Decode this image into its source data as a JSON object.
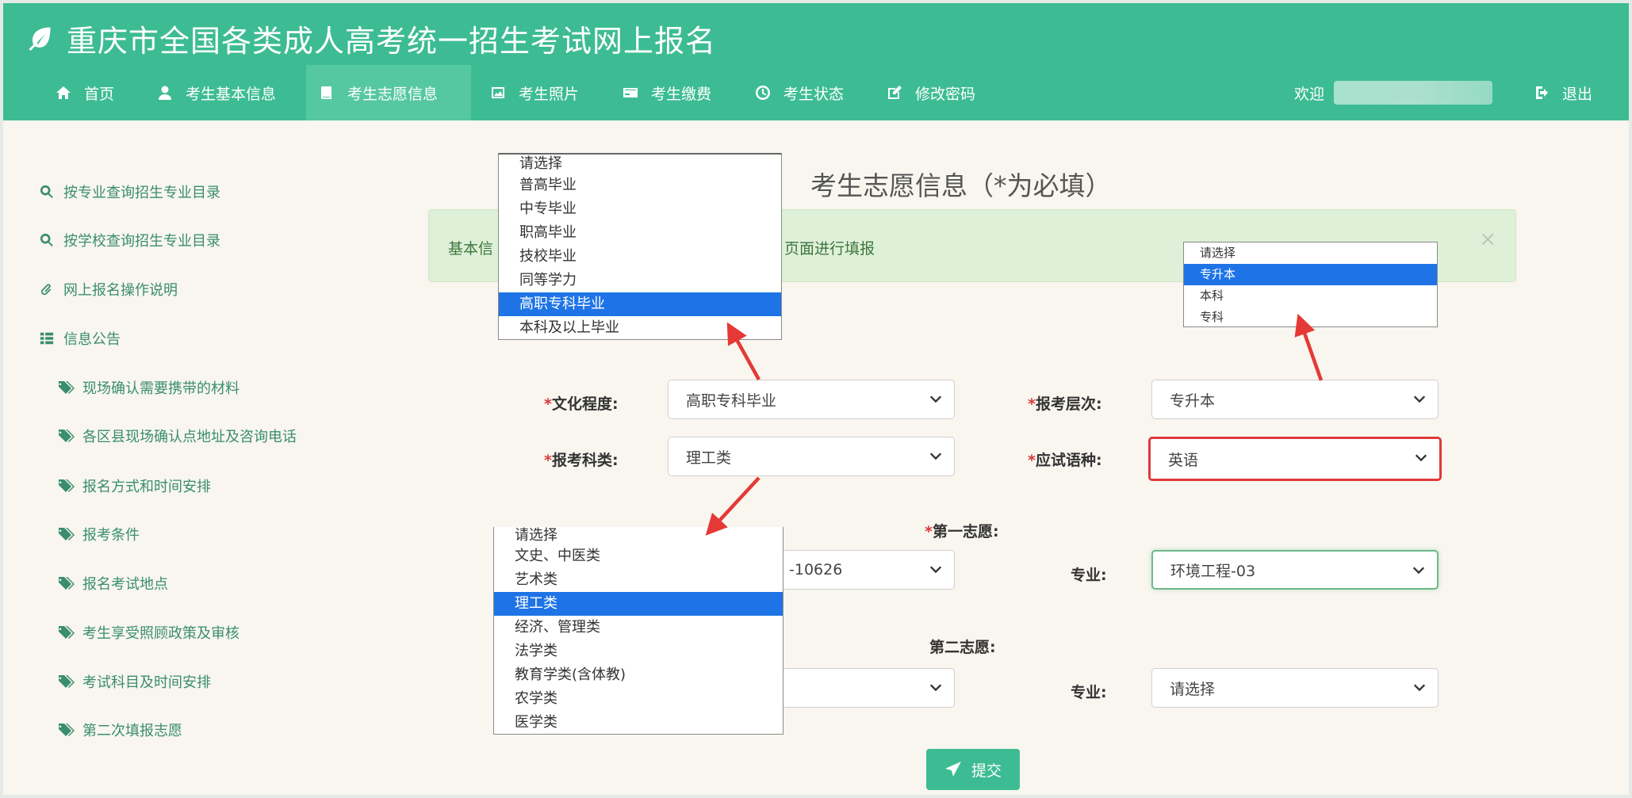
{
  "header": {
    "title": "重庆市全国各类成人高考统一招生考试网上报名",
    "nav": [
      {
        "label": "首页",
        "icon": "home-icon"
      },
      {
        "label": "考生基本信息",
        "icon": "user-icon"
      },
      {
        "label": "考生志愿信息",
        "icon": "book-icon"
      },
      {
        "label": "考生照片",
        "icon": "picture-icon"
      },
      {
        "label": "考生缴费",
        "icon": "card-icon"
      },
      {
        "label": "考生状态",
        "icon": "clock-icon"
      },
      {
        "label": "修改密码",
        "icon": "edit-icon"
      }
    ],
    "welcome": "欢迎",
    "logout": "退出"
  },
  "sidebar": {
    "links": [
      {
        "label": "按专业查询招生专业目录",
        "icon": "search-icon"
      },
      {
        "label": "按学校查询招生专业目录",
        "icon": "search-icon"
      },
      {
        "label": "网上报名操作说明",
        "icon": "paperclip-icon"
      },
      {
        "label": "信息公告",
        "icon": "list-icon"
      }
    ],
    "notices": [
      "现场确认需要携带的材料",
      "各区县现场确认点地址及咨询电话",
      "报名方式和时间安排",
      "报考条件",
      "报名考试地点",
      "考生享受照顾政策及审核",
      "考试科目及时间安排",
      "第二次填报志愿"
    ]
  },
  "form": {
    "title": "考生志愿信息（*为必填）",
    "alert_left": "基本信",
    "alert_right": "页面进行填报",
    "alert_close": "×",
    "culture_label": "文化程度:",
    "culture_value": "高职专科毕业",
    "level_label": "报考层次:",
    "level_value": "专升本",
    "subject_label": "报考科类:",
    "subject_value": "理工类",
    "language_label": "应试语种:",
    "language_value": "英语",
    "first_choice_label": "第一志愿:",
    "first_school_value": "-10626",
    "major_label": "专业:",
    "first_major_value": "环境工程-03",
    "second_choice_label": "第二志愿:",
    "second_major_label": "专业:",
    "second_major_value": "请选择",
    "required_mark": "*",
    "submit_label": "提交"
  },
  "dropdowns": {
    "culture": [
      "请选择",
      "普高毕业",
      "中专毕业",
      "职高毕业",
      "技校毕业",
      "同等学力",
      "高职专科毕业",
      "本科及以上毕业"
    ],
    "culture_selected": "高职专科毕业",
    "level": [
      "请选择",
      "专升本",
      "本科",
      "专科"
    ],
    "level_selected": "专升本",
    "subject": [
      "请选择",
      "文史、中医类",
      "艺术类",
      "理工类",
      "经济、管理类",
      "法学类",
      "教育学类(含体教)",
      "农学类",
      "医学类"
    ],
    "subject_selected": "理工类"
  },
  "colors": {
    "brand": "#3dbc93",
    "nav_active": "#56c8a1",
    "option_highlight": "#1e74e6",
    "annotation_arrow": "#e53935",
    "required": "#d9383a"
  }
}
